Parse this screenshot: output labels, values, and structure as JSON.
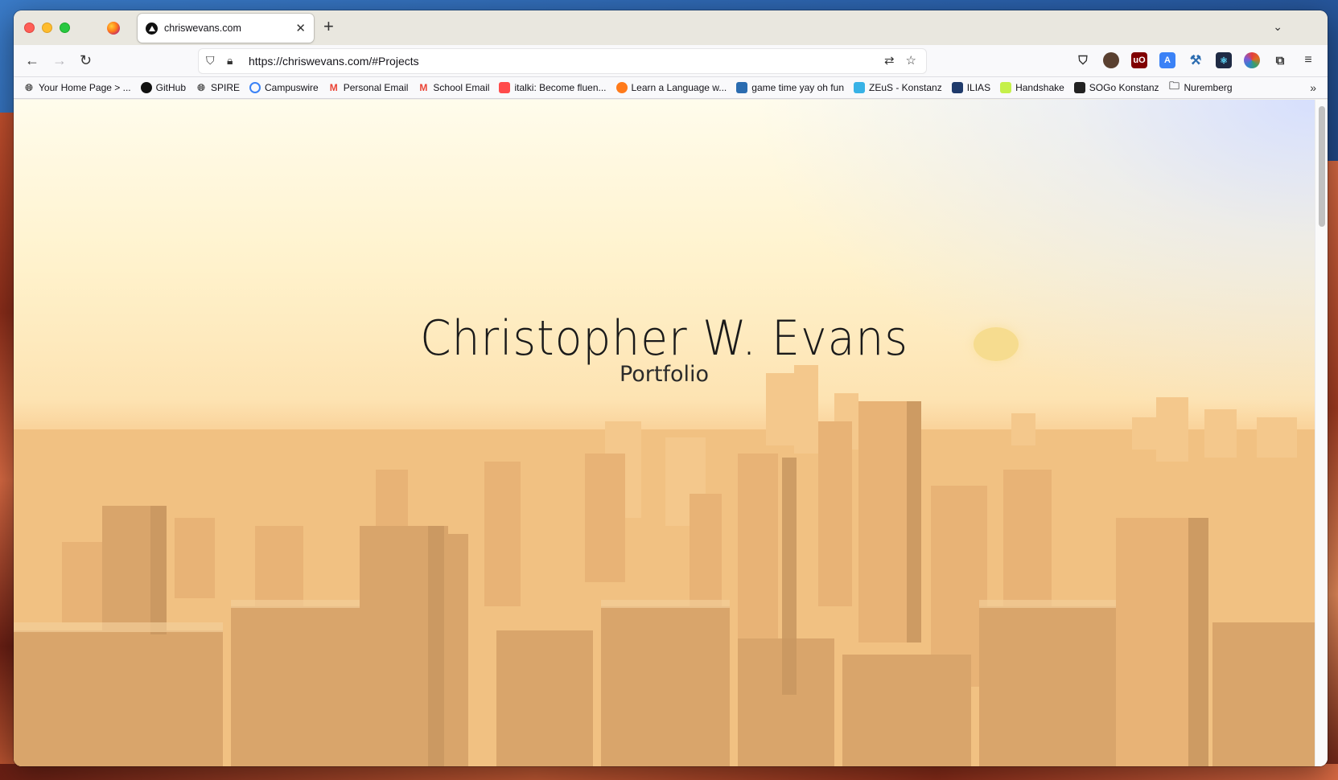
{
  "browser": {
    "tab": {
      "title": "chriswevans.com"
    },
    "new_tab_symbol": "+",
    "url": "https://chriswevans.com/#Projects"
  },
  "bookmarks": [
    {
      "label": "Your Home Page > ...",
      "icon": "globe-icon",
      "color": "#555555"
    },
    {
      "label": "GitHub",
      "icon": "github-icon",
      "color": "#111111"
    },
    {
      "label": "SPIRE",
      "icon": "globe-icon",
      "color": "#555555"
    },
    {
      "label": "Campuswire",
      "icon": "campuswire-icon",
      "color": "#3b82f6"
    },
    {
      "label": "Personal Email",
      "icon": "gmail-icon",
      "color": "#ea4335"
    },
    {
      "label": "School Email",
      "icon": "gmail-icon",
      "color": "#ea4335"
    },
    {
      "label": "italki: Become fluen...",
      "icon": "italki-icon",
      "color": "#ff4b4b"
    },
    {
      "label": "Learn a Language w...",
      "icon": "language-icon",
      "color": "#ff7a1a"
    },
    {
      "label": "game time yay oh fun",
      "icon": "game-icon",
      "color": "#2b6cb0"
    },
    {
      "label": "ZEuS - Konstanz",
      "icon": "zeus-icon",
      "color": "#38b2e6"
    },
    {
      "label": "ILIAS",
      "icon": "ilias-icon",
      "color": "#1f3a6b"
    },
    {
      "label": "Handshake",
      "icon": "handshake-icon",
      "color": "#c5f04a"
    },
    {
      "label": "SOGo Konstanz",
      "icon": "sogo-icon",
      "color": "#222222"
    },
    {
      "label": "Nuremberg",
      "icon": "folder-icon",
      "color": "#555555"
    }
  ],
  "hero": {
    "title": "Christopher W. Evans",
    "subtitle": "Portfolio"
  }
}
